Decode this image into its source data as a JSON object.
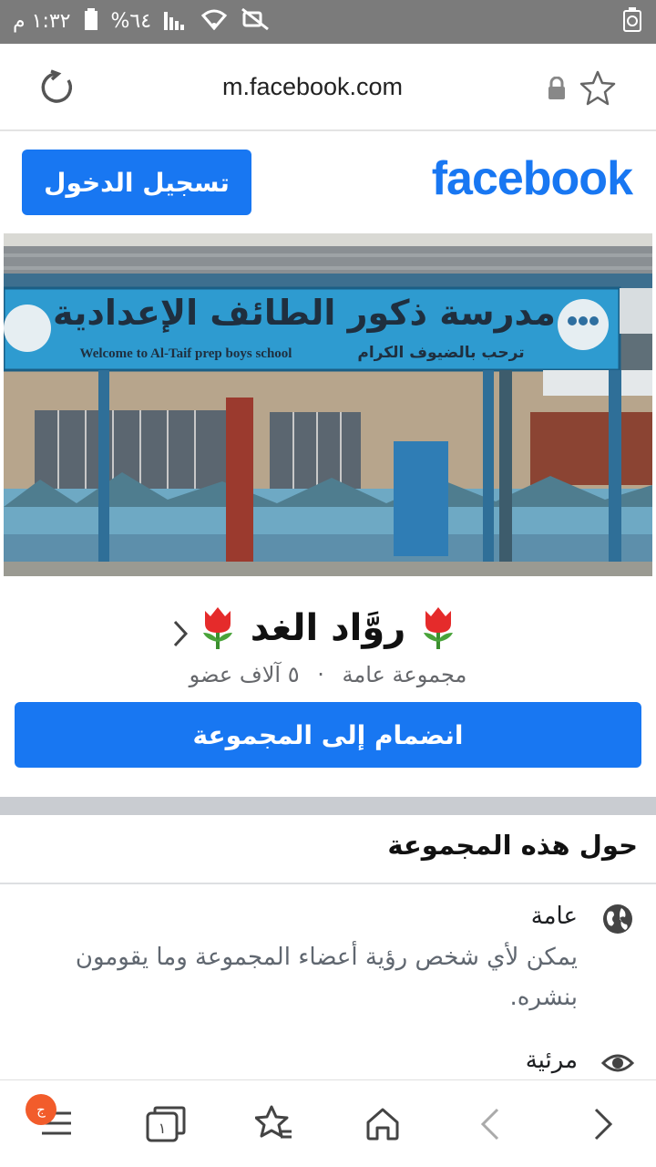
{
  "status_bar": {
    "time": "١:٣٢ م",
    "battery": "%٦٤"
  },
  "browser": {
    "url": "m.facebook.com"
  },
  "header": {
    "logo": "facebook",
    "login_label": "تسجيل الدخول"
  },
  "cover": {
    "sign_arabic": "مدرسة ذكور الطائف الإعدادية",
    "sign_english": "Welcome to Al-Taif prep boys school",
    "sign_subtitle": "ترحب بالضيوف الكرام"
  },
  "group": {
    "name": "روَّاد الغد",
    "privacy": "مجموعة عامة",
    "separator": "·",
    "members": "٥ آلاف عضو",
    "join_label": "انضمام إلى المجموعة"
  },
  "about": {
    "title": "حول هذه المجموعة",
    "items": [
      {
        "icon": "globe-icon",
        "heading": "عامة",
        "description": "يمكن لأي شخص رؤية أعضاء المجموعة وما يقومون بنشره."
      },
      {
        "icon": "eye-icon",
        "heading": "مرئية",
        "description": ""
      }
    ]
  },
  "bottom_nav": {
    "badge": "ج",
    "tabs_count": "١"
  },
  "colors": {
    "brand": "#1877f2",
    "status_bar": "#7b7b7b",
    "badge": "#f25c2b"
  }
}
